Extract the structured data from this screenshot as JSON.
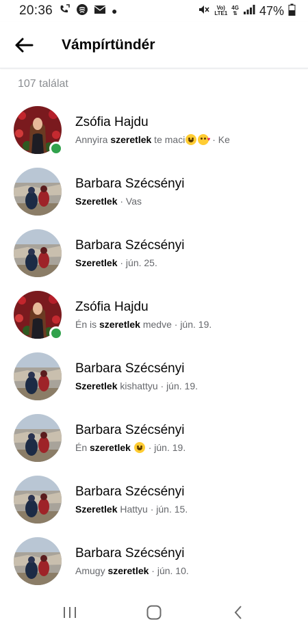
{
  "status_bar": {
    "time": "20:36",
    "network_top": "Vo)",
    "network_bottom": "LTE1",
    "network_type": "4G",
    "battery": "47%"
  },
  "header": {
    "title": "Vámpírtündér"
  },
  "results": {
    "count_label": "107 találat",
    "items": [
      {
        "name": "Zsófia Hajdu",
        "pre": "Annyira ",
        "match": "szeretlek",
        "post": " te maci",
        "emoji": "laugh-kiss",
        "tail": " · Ke",
        "avatar": "woman-flowers",
        "online": true
      },
      {
        "name": "Barbara Szécsényi",
        "pre": "",
        "match": "Szeretlek",
        "post": "",
        "emoji": "",
        "tail": " · Vas",
        "avatar": "couple-landscape",
        "online": false
      },
      {
        "name": "Barbara Szécsényi",
        "pre": "",
        "match": "Szeretlek",
        "post": "",
        "emoji": "",
        "tail": " · jún. 25.",
        "avatar": "couple-landscape",
        "online": false
      },
      {
        "name": "Zsófia Hajdu",
        "pre": "Én is ",
        "match": "szeretlek",
        "post": " medve",
        "emoji": "",
        "tail": " · jún. 19.",
        "avatar": "woman-flowers",
        "online": true
      },
      {
        "name": "Barbara Szécsényi",
        "pre": "",
        "match": "Szeretlek",
        "post": " kishattyu",
        "emoji": "",
        "tail": " · jún. 19.",
        "avatar": "couple-landscape",
        "online": false
      },
      {
        "name": "Barbara Szécsényi",
        "pre": "Én ",
        "match": "szeretlek",
        "post": " ",
        "emoji": "grin",
        "tail": " · jún. 19.",
        "avatar": "couple-landscape",
        "online": false
      },
      {
        "name": "Barbara Szécsényi",
        "pre": "",
        "match": "Szeretlek",
        "post": " Hattyu",
        "emoji": "",
        "tail": " · jún. 15.",
        "avatar": "couple-landscape",
        "online": false
      },
      {
        "name": "Barbara Szécsényi",
        "pre": "Amugy ",
        "match": "szeretlek",
        "post": "",
        "emoji": "",
        "tail": " · jún. 10.",
        "avatar": "couple-landscape",
        "online": false
      }
    ]
  },
  "colors": {
    "online": "#31a24c",
    "secondary_text": "#65676b",
    "count_text": "#8a8d91"
  },
  "icons": {
    "back": "arrow-left-icon",
    "nav_recents": "recent-apps-icon",
    "nav_home": "home-icon",
    "nav_back": "nav-back-icon"
  }
}
